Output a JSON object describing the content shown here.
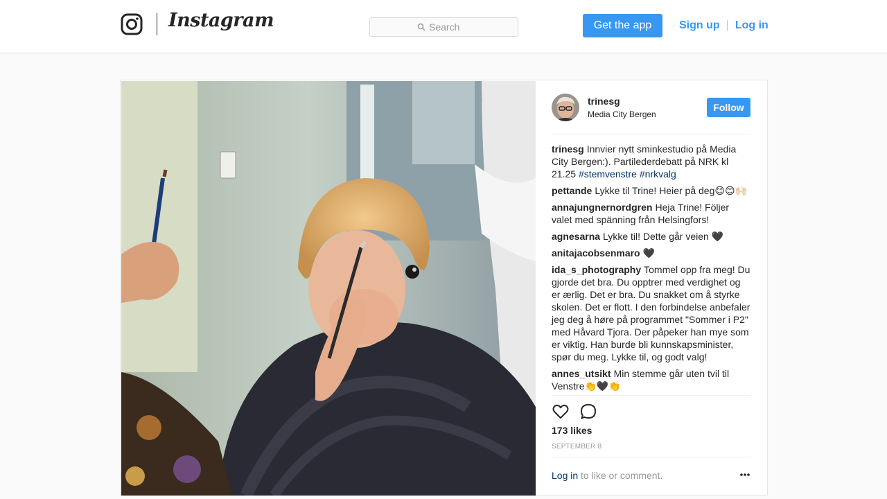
{
  "header": {
    "brand": "Instagram",
    "search_placeholder": "Search",
    "get_app_label": "Get the app",
    "signup_label": "Sign up",
    "separator": "|",
    "login_label": "Log in",
    "accent_color": "#3897f0"
  },
  "post": {
    "author": {
      "username": "trinesg",
      "location": "Media City Bergen",
      "follow_label": "Follow"
    },
    "caption": {
      "username": "trinesg",
      "text": "Innvier nytt sminkestudio på Media City Bergen:). Partilederdebatt på NRK kl 21.25",
      "hashtags": [
        "#stemvenstre",
        "#nrkvalg"
      ]
    },
    "comments": [
      {
        "username": "pettande",
        "text": "Lykke til Trine! Heier på deg😊😊🙌🏻"
      },
      {
        "username": "annajungnernordgren",
        "text": "Heja Trine! Följer valet med spänning från Helsingfors!"
      },
      {
        "username": "agnesarna",
        "text": "Lykke til! Dette går veien 🖤"
      },
      {
        "username": "anitajacobsenmaro",
        "text": "🖤"
      },
      {
        "username": "ida_s_photography",
        "text": "Tommel opp fra meg! Du gjorde det bra. Du opptrer med verdighet og er ærlig. Det er bra. Du snakket om å styrke skolen. Det er flott. I den forbindelse anbefaler jeg deg å høre på programmet \"Sommer i P2\" med Håvard Tjora. Der påpeker han mye som er viktig. Han burde bli kunnskapsminister, spør du meg. Lykke til, og godt valg!"
      },
      {
        "username": "annes_utsikt",
        "text": "Min stemme går uten tvil til Venstre👏🖤👏"
      }
    ],
    "likes": "173 likes",
    "date": "SEPTEMBER 8",
    "login_prompt": {
      "link": "Log in",
      "rest": " to like or comment."
    },
    "icons": [
      "heart-icon",
      "comment-icon",
      "more-options-icon"
    ],
    "link_color": "#003569"
  }
}
